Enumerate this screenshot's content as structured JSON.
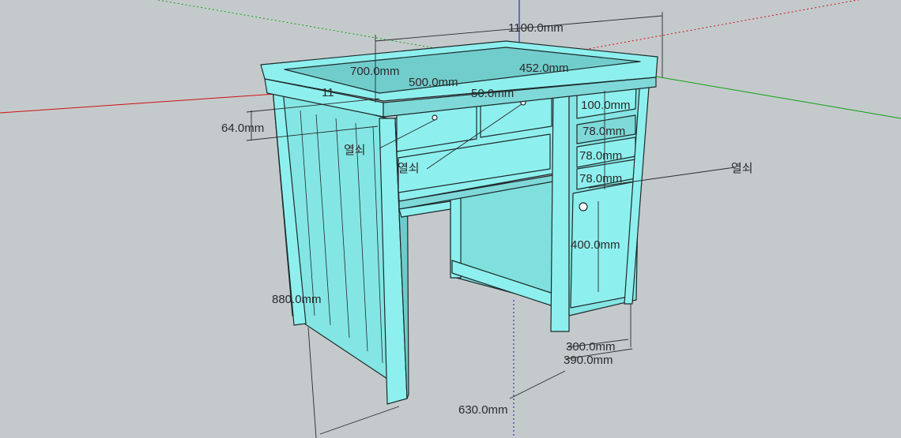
{
  "colors": {
    "background": "#c4cacc",
    "desk_face": "#8ef0ee",
    "desk_shade": "#7fd9d8",
    "desk_dark": "#66c2c2",
    "axis_red": "#d01010",
    "axis_green": "#10a010",
    "axis_blue": "#1010c0"
  },
  "dimensions": {
    "width_total": "1100.0mm",
    "depth_top": "700.0mm",
    "drawer_section": "500.0mm",
    "side_cabinet": "452.0mm",
    "small_gap": "50.0mm",
    "partial_11": "11",
    "rail_height": "64.0mm",
    "top_drawer": "100.0mm",
    "drawer_1": "78.0mm",
    "drawer_2": "78.0mm",
    "drawer_3": "78.0mm",
    "door": "400.0mm",
    "height_total": "880.0mm",
    "leg_depth": "300.0mm",
    "cabinet_depth": "390.0mm",
    "knee_space": "630.0mm"
  },
  "callouts": {
    "key_1": "열쇠",
    "key_2": "열쇠",
    "key_3": "열쇠"
  }
}
